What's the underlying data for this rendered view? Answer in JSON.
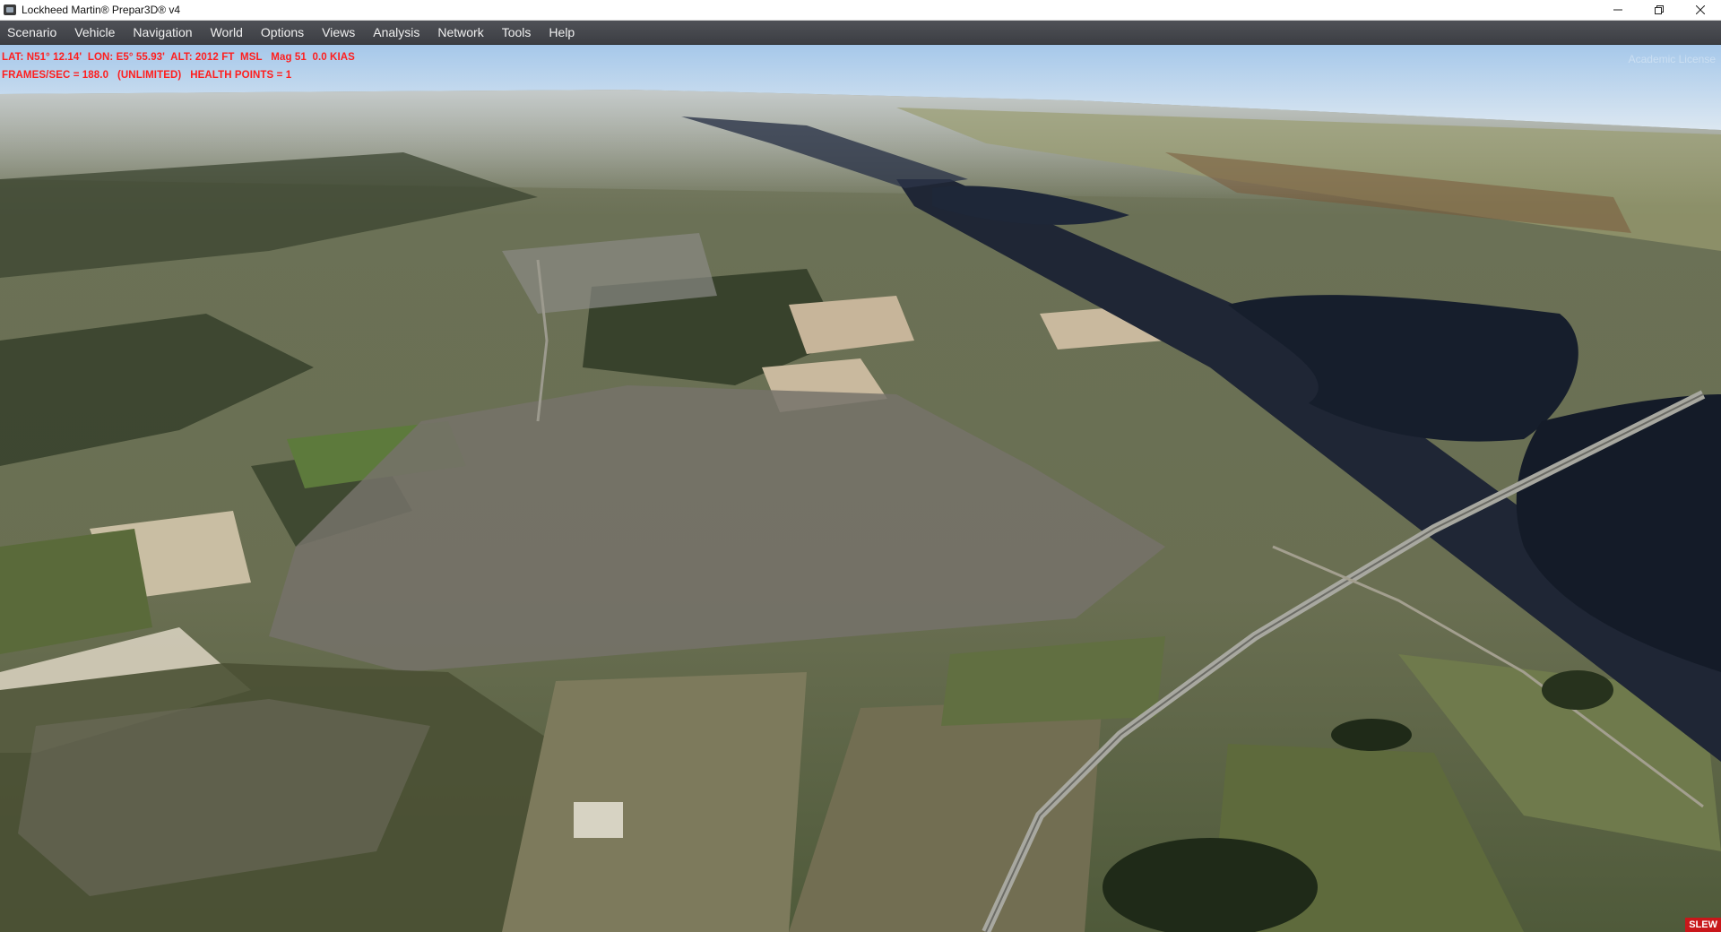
{
  "window": {
    "title": "Lockheed Martin® Prepar3D® v4"
  },
  "menu": [
    {
      "label": "Scenario"
    },
    {
      "label": "Vehicle"
    },
    {
      "label": "Navigation"
    },
    {
      "label": "World"
    },
    {
      "label": "Options"
    },
    {
      "label": "Views"
    },
    {
      "label": "Analysis"
    },
    {
      "label": "Network"
    },
    {
      "label": "Tools"
    },
    {
      "label": "Help"
    }
  ],
  "hud": {
    "line1": "LAT: N51° 12.14'  LON: E5° 55.93'  ALT: 2012 FT  MSL   Mag 51  0.0 KIAS",
    "line2": "FRAMES/SEC = 188.0   (UNLIMITED)   HEALTH POINTS = 1",
    "color": "#ff1e1e"
  },
  "watermark": "Academic License",
  "mode_badge": "SLEW",
  "colors": {
    "sky_top": "#9fc3e6",
    "horizon": "#dfe9f1",
    "land": "#6f7652",
    "water": "#1c2433",
    "badge": "#c8171a"
  }
}
